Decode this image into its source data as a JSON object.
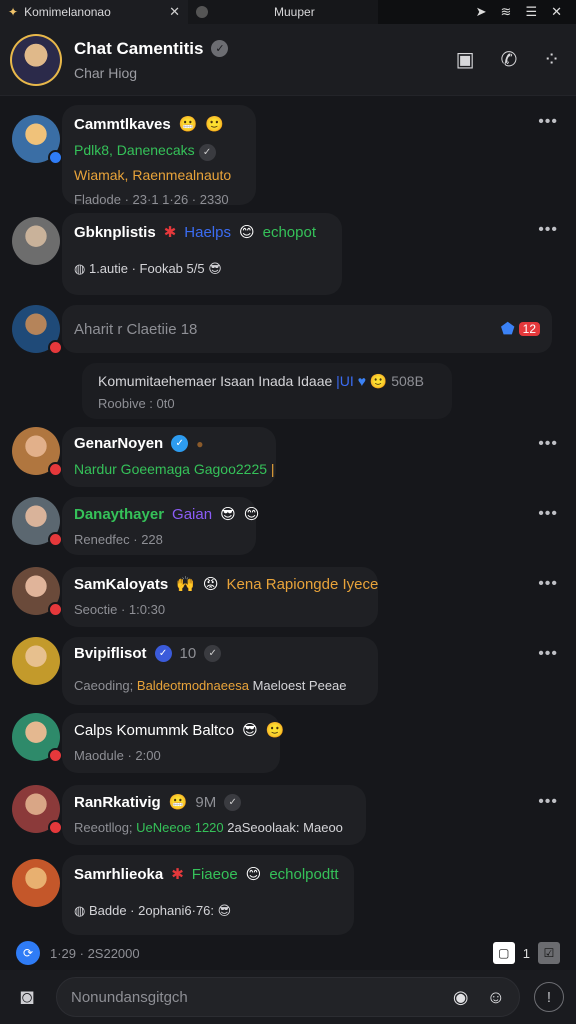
{
  "tabs": [
    {
      "label": "Komimelanonao",
      "icon": "app-icon"
    },
    {
      "label": "Muuper",
      "icon": "app-icon"
    }
  ],
  "header": {
    "title": "Chat Camentitis",
    "subtitle": "Char Hiog"
  },
  "rows": [
    {
      "name": "Cammtlkaves",
      "line2a": "Pdlk8, Danenecaks",
      "line2b": "Wiamak, Raenmealnauto",
      "line3": "Fladode · 23·1 1·26 · 2330",
      "avatar_color": "#3a6ea5"
    },
    {
      "name": "Gbknplistis",
      "tag": "Haelps",
      "tag2": "echopot",
      "line3": "1.autie · Fookab 5/5",
      "avatar_color": "#7a7a7a"
    },
    {
      "name": "Aharit r Claetiie 18",
      "count": "12",
      "avatar_color": "#1f4a78"
    },
    {
      "quote": "Komumitaehemaer Isaan Inada Idaae",
      "quote_link": "|UI",
      "quote_extra": "508B",
      "quote_sub": "Roobive : 0t0"
    },
    {
      "name": "GenarNoyen",
      "line2": "Nardur Goeemaga Gagoo2225",
      "avatar_color": "#b0763f"
    },
    {
      "name": "Danaythayer",
      "tag": "Gaian",
      "line3": "Renedfec · 228",
      "avatar_color": "#5b6770"
    },
    {
      "name": "SamKaloyats",
      "tag": "Kena Rapiongde Iyece",
      "line3": "Seoctie · 1:0:30",
      "avatar_color": "#6a4a3a"
    },
    {
      "name": "Bvipiflisot",
      "tag": "10",
      "line3a": "Caeoding;",
      "line3b": "Baldeotmodnaeesa",
      "line3c": "Maeloest Peeae",
      "avatar_color": "#c39a2b"
    },
    {
      "name": "Calps Komummk Baltco",
      "line3": "Maodule · 2:00",
      "avatar_color": "#2e8a6a"
    },
    {
      "name": "RanRkativig",
      "tag": "9M",
      "line3a": "Reeotllog;",
      "line3b": "UeNeeoe 1220",
      "line3c": "2aSeoolaak: Maeoo",
      "avatar_color": "#8b3a3a"
    },
    {
      "name": "Samrhlieoka",
      "tag": "Fiaeoe",
      "tag2": "echolpodtt",
      "line3": "Badde · 2ophani6·76:",
      "avatar_color": "#c4572a"
    }
  ],
  "bottom_status": {
    "text": "1·29 · 2S22000",
    "count": "1"
  },
  "composer": {
    "placeholder": "Nonundansgitgch"
  }
}
